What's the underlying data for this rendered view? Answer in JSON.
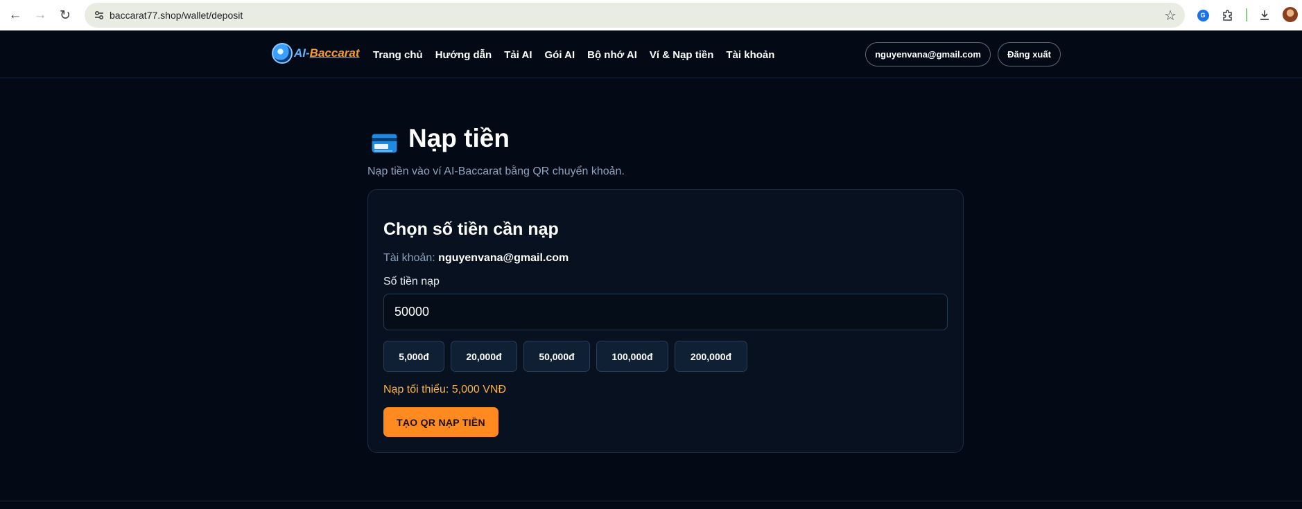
{
  "browser": {
    "url": "baccarat77.shop/wallet/deposit",
    "back_icon": "arrow-left-icon",
    "forward_icon": "arrow-right-icon",
    "reload_icon": "reload-icon"
  },
  "header": {
    "menu": [
      "Trang chủ",
      "Hướng dẫn",
      "Tải AI",
      "Gói AI",
      "Bộ nhớ AI",
      "Ví & Nạp tiền",
      "Tài khoản"
    ],
    "user_email": "nguyenvana@gmail.com",
    "logout": "Đăng xuất"
  },
  "page": {
    "title": "Nạp tiền",
    "subtitle": "Nạp tiền vào ví AI-Baccarat bằng QR chuyển khoản."
  },
  "card": {
    "title": "Chọn số tiền cần nạp",
    "account_label": "Tài khoản:",
    "account_value": "nguyenvana@gmail.com",
    "amount_label": "Số tiền nạp",
    "amount_value": "50000",
    "presets": [
      "5,000đ",
      "20,000đ",
      "50,000đ",
      "100,000đ",
      "200,000đ"
    ],
    "min_note": "Nạp tối thiểu: 5,000 VNĐ",
    "submit": "TẠO QR NẠP TIỀN"
  },
  "colors": {
    "background": "#030a15",
    "accent": "#ff8a1f",
    "note": "#f5b54a"
  }
}
